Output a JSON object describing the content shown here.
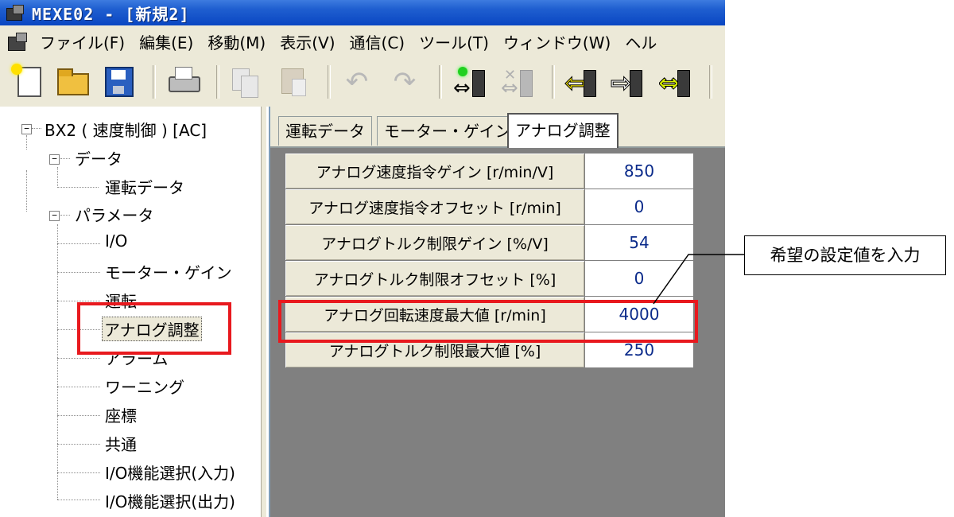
{
  "window": {
    "title": "MEXE02 - [新規2]"
  },
  "menu": {
    "items": [
      "ファイル(F)",
      "編集(E)",
      "移動(M)",
      "表示(V)",
      "通信(C)",
      "ツール(T)",
      "ウィンドウ(W)",
      "ヘル"
    ]
  },
  "toolbar": {
    "icons": [
      "new-file-icon",
      "open-folder-icon",
      "save-icon",
      "print-icon",
      "copy-icon",
      "paste-icon",
      "undo-icon",
      "redo-icon",
      "connect-icon",
      "disconnect-icon",
      "read-from-device-icon",
      "write-to-device-icon",
      "verify-icon"
    ]
  },
  "tree": {
    "root": "BX2 ( 速度制御 ) [AC]",
    "data_folder": "データ",
    "data_items": [
      "運転データ"
    ],
    "param_folder": "パラメータ",
    "param_items": [
      "I/O",
      "モーター・ゲイン",
      "運転",
      "アナログ調整",
      "アラーム",
      "ワーニング",
      "座標",
      "共通",
      "I/O機能選択(入力)",
      "I/O機能選択(出力)"
    ],
    "selected": "アナログ調整"
  },
  "tabs": {
    "items": [
      "運転データ",
      "モーター・ゲイン",
      "アナログ調整"
    ],
    "active": "アナログ調整"
  },
  "params": {
    "rows": [
      {
        "label": "アナログ速度指令ゲイン [r/min/V]",
        "value": "850"
      },
      {
        "label": "アナログ速度指令オフセット [r/min]",
        "value": "0"
      },
      {
        "label": "アナログトルク制限ゲイン [%/V]",
        "value": "54"
      },
      {
        "label": "アナログトルク制限オフセット [%]",
        "value": "0"
      },
      {
        "label": "アナログ回転速度最大値 [r/min]",
        "value": "4000"
      },
      {
        "label": "アナログトルク制限最大値 [%]",
        "value": "250"
      }
    ]
  },
  "annotation": {
    "text": "希望の設定値を入力"
  },
  "colors": {
    "highlight": "#e8191e",
    "titlebar": "#0a46c2",
    "value_text": "#0a2a8a"
  }
}
